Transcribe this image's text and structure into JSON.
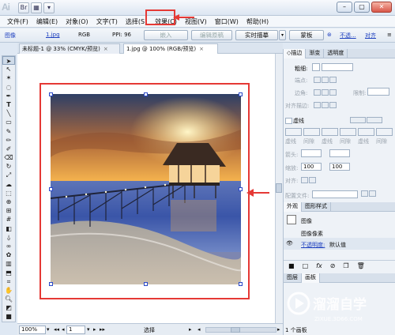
{
  "titlebar": {
    "logo": "Ai",
    "window_buttons": [
      "minimize",
      "maximize",
      "close"
    ]
  },
  "menubar": {
    "items": [
      "文件(F)",
      "编辑(E)",
      "对象(O)",
      "文字(T)",
      "选择(S)",
      "效果(C)",
      "视图(V)",
      "窗口(W)",
      "帮助(H)"
    ],
    "highlighted": "效果(C)",
    "annotation_color": "#e53935"
  },
  "controlbar": {
    "object_type": "图像",
    "filename": "1.jpg",
    "color_mode": "RGB",
    "ppi": "PPI: 96",
    "embed_button": "嵌入",
    "edit_original_button": "编辑原稿",
    "live_trace_button": "实时描摹",
    "mask_button": "蒙板",
    "opacity_label": "不透...",
    "align_label": "对齐"
  },
  "doctabs": [
    {
      "label": "未标题-1 @ 33% (CMYK/预览)",
      "close": "×"
    },
    {
      "label": "1.jpg @ 100% (RGB/预览)",
      "close": "×"
    }
  ],
  "statusbar": {
    "zoom": "100%",
    "page": "1",
    "tool_label": "选择"
  },
  "stroke_panel": {
    "tabs": [
      "◇描边",
      "渐变",
      "透明度"
    ],
    "weight_label": "粗细:",
    "cap_label": "端点:",
    "corner_label": "边角:",
    "limit_label": "限制:",
    "align_label": "对齐描边:",
    "dashed_label": "虚线",
    "dash_fields": [
      "虚线",
      "间隙",
      "虚线",
      "间隙",
      "虚线",
      "间隙"
    ],
    "arrow_label": "箭头:",
    "scale_label": "缩放:",
    "scale_values": [
      "100",
      "100"
    ],
    "align_arrow_label": "对齐:",
    "profile_label": "配置文件:"
  },
  "appearance_panel": {
    "tabs": [
      "外观",
      "图形样式"
    ],
    "object_name": "图像",
    "row1": "图像像素",
    "opacity_link": "不透明度:",
    "opacity_value": "默认值",
    "footer_icons": [
      "fx-icon",
      "clear-icon",
      "duplicate-icon",
      "delete-icon"
    ]
  },
  "layers_panel": {
    "tabs": [
      "图层",
      "画板"
    ],
    "count_label": "1 个画板"
  },
  "watermark": {
    "brand": "溜溜自学",
    "url": "ZIXUE.3D66.COM"
  }
}
